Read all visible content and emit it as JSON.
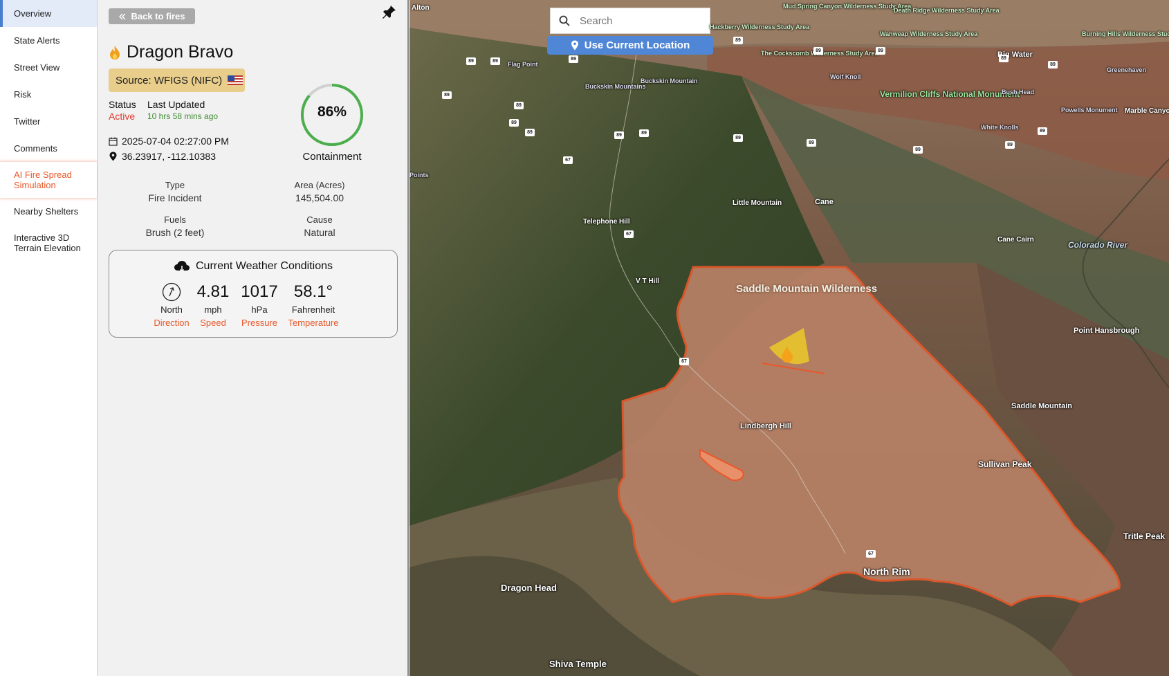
{
  "nav": {
    "items": [
      {
        "label": "Overview"
      },
      {
        "label": "State Alerts"
      },
      {
        "label": "Street View"
      },
      {
        "label": "Risk"
      },
      {
        "label": "Twitter"
      },
      {
        "label": "Comments"
      },
      {
        "label": "AI Fire Spread Simulation"
      },
      {
        "label": "Nearby Shelters"
      },
      {
        "label": "Interactive 3D Terrain Elevation"
      }
    ]
  },
  "panel": {
    "back_label": "Back to fires",
    "fire_name": "Dragon Bravo",
    "source": "Source: WFIGS (NIFC)",
    "status_label": "Status",
    "status_value": "Active",
    "updated_label": "Last Updated",
    "updated_value": "10 hrs 58 mins ago",
    "date": "2025-07-04 02:27:00 PM",
    "coords": "36.23917, -112.10383",
    "containment_percent": 86,
    "containment_text": "86%",
    "containment_label": "Containment",
    "fields": {
      "type_label": "Type",
      "type_value": "Fire Incident",
      "area_label": "Area (Acres)",
      "area_value": "145,504.00",
      "fuels_label": "Fuels",
      "fuels_value": "Brush (2 feet)",
      "cause_label": "Cause",
      "cause_value": "Natural"
    },
    "weather": {
      "title": "Current Weather Conditions",
      "direction_value": "North",
      "direction_tag": "Direction",
      "speed_value": "4.81",
      "speed_unit": "mph",
      "speed_tag": "Speed",
      "pressure_value": "1017",
      "pressure_unit": "hPa",
      "pressure_tag": "Pressure",
      "temp_value": "58.1°",
      "temp_unit": "Fahrenheit",
      "temp_tag": "Temperature"
    }
  },
  "map": {
    "search_placeholder": "Search",
    "locate_label": "Use Current Location",
    "labels": {
      "alton": "Alton",
      "hackberry": "Hackberry Wilderness Study Area",
      "mud_spring": "Mud Spring Canyon Wilderness Study Area",
      "death_ridge": "Death Ridge Wilderness Study Area",
      "wahweap": "Wahweap Wilderness Study Area",
      "cockscomb": "The Cockscomb Wilderness Study Area",
      "burning_hills": "Burning Hills Wilderness Study Area",
      "big_water": "Big Water",
      "greenehaven": "Greenehaven",
      "flag_point": "Flag Point",
      "wolf_knoll": "Wolf Knoll",
      "buckskin_mtns": "Buckskin Mountains",
      "buckskin_mtn": "Buckskin Mountain",
      "vermilion": "Vermilion Cliffs National Monument",
      "bush_head": "Bush Head",
      "powells": "Powells Monument",
      "marble": "Marble Canyon",
      "white_knolls": "White Knolls",
      "points": "Points",
      "little_mtn": "Little Mountain",
      "cane": "Cane",
      "telephone": "Telephone Hill",
      "cane_cairn": "Cane Cairn",
      "colorado": "Colorado River",
      "vt_hill": "V T Hill",
      "saddle_wild": "Saddle Mountain Wilderness",
      "point_hansbrough": "Point Hansbrough",
      "saddle_mtn": "Saddle Mountain",
      "lindbergh": "Lindbergh Hill",
      "sullivan": "Sullivan Peak",
      "tritle": "Tritle Peak",
      "dragon_head": "Dragon Head",
      "north_rim": "North Rim",
      "shiva": "Shiva Temple"
    },
    "shields": {
      "us89": "89",
      "az67": "67"
    }
  }
}
